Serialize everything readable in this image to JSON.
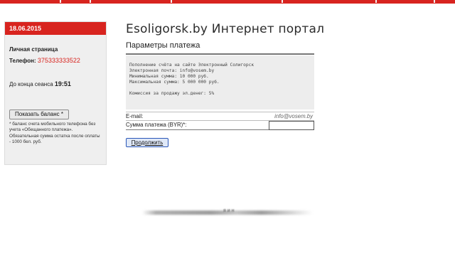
{
  "sidebar": {
    "date": "18.06.2015",
    "personal_page": "Личная страница",
    "phone_label": "Телефон:",
    "phone_number": "375333333522",
    "session_label": "До конца сеанса",
    "session_time": "19:51",
    "balance_button": "Показать баланс *",
    "note": "* баланс счета мобильного телефона без учета «Обещанного платежа». Обязательная сумма остатка после оплаты - 1000 бел. руб."
  },
  "header": {
    "site_title": "Esoligorsk.by Интернет портал"
  },
  "payment": {
    "section_title": "Параметры платежа",
    "info_lines": [
      "Пополнение счёта на сайте Электронный Солигорск",
      "Электронная почта: info@vosem.by",
      "Минимальная сумма: 10 000 руб.",
      "Максимальная сумма: 5 000 000 руб."
    ],
    "commission_line": "Комиссия за продажу эл.денег: 5%",
    "email_label": "E-mail:",
    "email_value": "info@vosem.by",
    "amount_label": "Сумма платежа (BYR)*:",
    "amount_value": "",
    "continue_button": "Продолжить"
  },
  "footer": {
    "blurred_text": "я и н"
  },
  "colors": {
    "accent": "#d8241f",
    "panel_bg": "#efefef",
    "info_bg": "#ededed"
  }
}
